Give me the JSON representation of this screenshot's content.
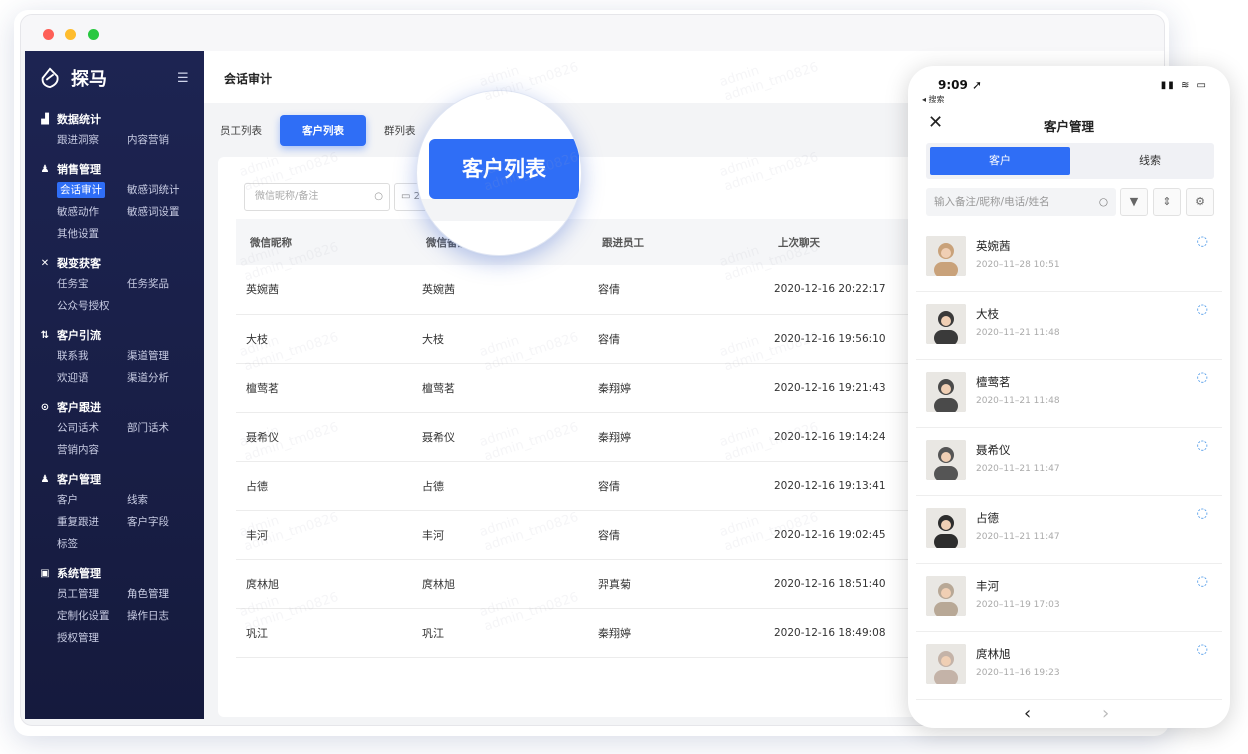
{
  "window": {
    "controls": [
      "close",
      "minimize",
      "maximize"
    ]
  },
  "brand": {
    "name": "探马"
  },
  "sidebar": {
    "sections": [
      {
        "title": "数据统计",
        "icon": "bar-chart-icon",
        "items": [
          "跟进洞察",
          "内容营销"
        ]
      },
      {
        "title": "销售管理",
        "icon": "user-icon",
        "items": [
          "会话审计",
          "敏感词统计",
          "敏感动作",
          "敏感词设置",
          "其他设置"
        ],
        "active": "会话审计"
      },
      {
        "title": "裂变获客",
        "icon": "share-icon",
        "items": [
          "任务宝",
          "任务奖品",
          "公众号授权"
        ]
      },
      {
        "title": "客户引流",
        "icon": "flow-icon",
        "items": [
          "联系我",
          "渠道管理",
          "欢迎语",
          "渠道分析"
        ]
      },
      {
        "title": "客户跟进",
        "icon": "target-icon",
        "items": [
          "公司话术",
          "部门话术",
          "营销内容"
        ]
      },
      {
        "title": "客户管理",
        "icon": "users-icon",
        "items": [
          "客户",
          "线索",
          "重复跟进",
          "客户字段",
          "标签"
        ]
      },
      {
        "title": "系统管理",
        "icon": "settings-icon",
        "items": [
          "员工管理",
          "角色管理",
          "定制化设置",
          "操作日志",
          "授权管理"
        ]
      }
    ]
  },
  "header": {
    "title": "会话审计"
  },
  "tabs": [
    {
      "label": "员工列表",
      "active": false
    },
    {
      "label": "客户列表",
      "active": true
    },
    {
      "label": "群列表",
      "active": false
    }
  ],
  "filters": {
    "search_placeholder": "微信昵称/备注",
    "date_partial": "2"
  },
  "magnifier": {
    "label": "客户列表"
  },
  "table": {
    "headers": [
      "微信昵称",
      "微信备注",
      "跟进员工",
      "上次聊天"
    ],
    "rows": [
      [
        "英婉茜",
        "英婉茜",
        "容倩",
        "2020-12-16 20:22:17"
      ],
      [
        "大枝",
        "大枝",
        "容倩",
        "2020-12-16 19:56:10"
      ],
      [
        "檀莺茗",
        "檀莺茗",
        "秦翔婷",
        "2020-12-16 19:21:43"
      ],
      [
        "聂希仪",
        "聂希仪",
        "秦翔婷",
        "2020-12-16 19:14:24"
      ],
      [
        "占德",
        "占德",
        "容倩",
        "2020-12-16 19:13:41"
      ],
      [
        "丰河",
        "丰河",
        "容倩",
        "2020-12-16 19:02:45"
      ],
      [
        "庹林旭",
        "庹林旭",
        "羿真菊",
        "2020-12-16 18:51:40"
      ],
      [
        "巩江",
        "巩江",
        "秦翔婷",
        "2020-12-16 18:49:08"
      ]
    ]
  },
  "watermark": {
    "line1": "admin",
    "line2": "admin_tm0826"
  },
  "phone": {
    "time": "9:09",
    "back_label": "◂ 搜索",
    "title": "客户管理",
    "segments": [
      "客户",
      "线索"
    ],
    "search_placeholder": "输入备注/昵称/电话/姓名",
    "customers": [
      {
        "name": "英婉茜",
        "date": "2020–11–28 10:51"
      },
      {
        "name": "大枝",
        "date": "2020–11–21 11:48"
      },
      {
        "name": "檀莺茗",
        "date": "2020–11–21 11:48"
      },
      {
        "name": "聂希仪",
        "date": "2020–11–21 11:47"
      },
      {
        "name": "占德",
        "date": "2020–11–21 11:47"
      },
      {
        "name": "丰河",
        "date": "2020–11–19 17:03"
      },
      {
        "name": "庹林旭",
        "date": "2020–11–16 19:23"
      }
    ]
  },
  "colors": {
    "primary": "#2f6ef6",
    "sidebar_bg": "#1d2452"
  }
}
